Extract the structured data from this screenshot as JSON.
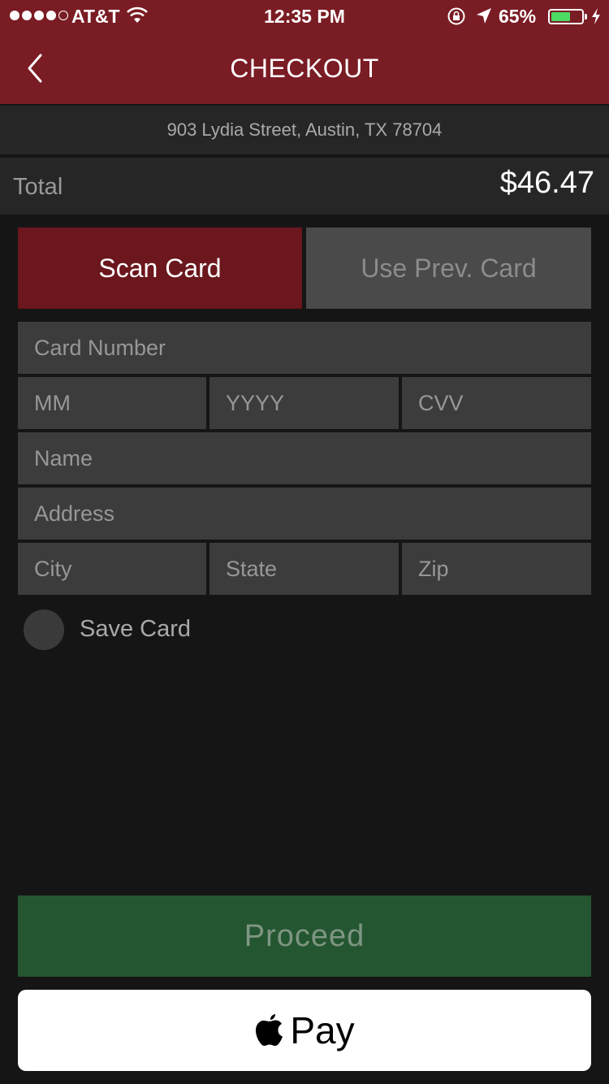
{
  "status_bar": {
    "carrier": "AT&T",
    "time": "12:35 PM",
    "battery": "65%",
    "battery_level": 0.65,
    "signal_bars": 4
  },
  "nav": {
    "title": "CHECKOUT",
    "back_icon": "chevron-left-icon"
  },
  "order": {
    "address": "903 Lydia Street, Austin, TX 78704",
    "total_label": "Total",
    "total_value": "$46.47"
  },
  "card_buttons": {
    "scan": "Scan Card",
    "previous": "Use Prev. Card"
  },
  "form": {
    "card_number": "Card Number",
    "month": "MM",
    "year": "YYYY",
    "cvv": "CVV",
    "name": "Name",
    "address": "Address",
    "city": "City",
    "state": "State",
    "zip": "Zip",
    "save_card": "Save Card"
  },
  "actions": {
    "proceed": "Proceed",
    "apple_pay": "Pay"
  },
  "colors": {
    "brand_red": "#7a1c24",
    "scan_button": "#6b171d",
    "proceed_green": "#245631",
    "background": "#151515"
  }
}
